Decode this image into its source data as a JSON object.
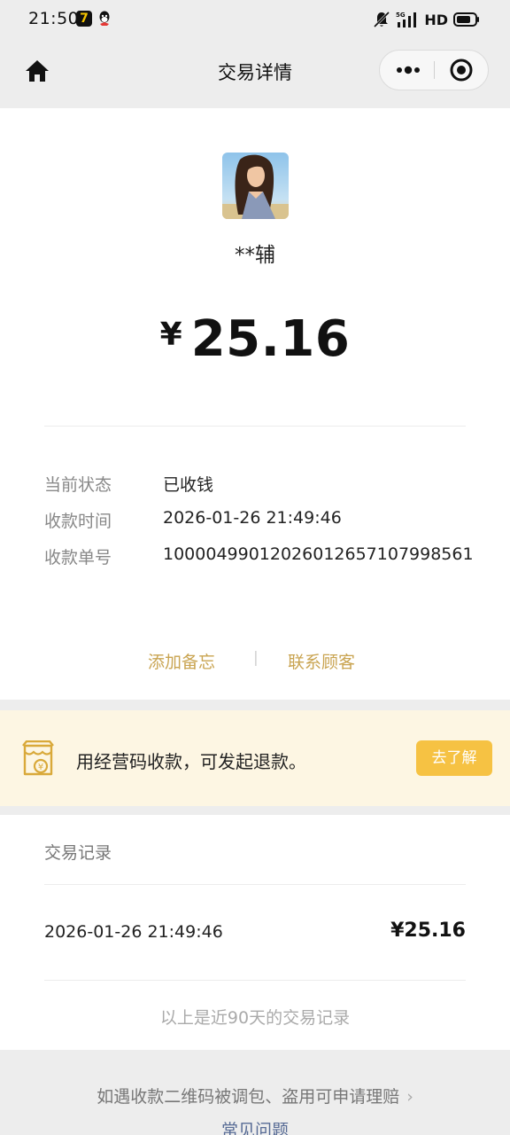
{
  "status_bar": {
    "time": "21:50",
    "network": "5G",
    "hd": "HD"
  },
  "nav": {
    "title": "交易详情"
  },
  "merchant": {
    "name": "**辅"
  },
  "amount": {
    "currency": "¥",
    "value": "25.16"
  },
  "details": [
    {
      "label": "当前状态",
      "value": "已收钱"
    },
    {
      "label": "收款时间",
      "value": "2026-01-26 21:49:46"
    },
    {
      "label": "收款单号",
      "value": "1000049901202601265710799856​1"
    }
  ],
  "actions": {
    "remark": "添加备忘",
    "separator": "|",
    "contact": "联系顾客"
  },
  "banner": {
    "text": "用经营码收款，可发起退款。",
    "button": "去了解"
  },
  "records": {
    "title": "交易记录",
    "items": [
      {
        "time": "2026-01-26 21:49:46",
        "amount": "¥25.16"
      }
    ],
    "footer": "以上是近90天的交易记录"
  },
  "bottom": {
    "claim": "如遇收款二维码被调包、盗用可申请理赔",
    "faq": "常见问题"
  },
  "colors": {
    "accent_gold": "#c9a451",
    "button_yellow": "#f6c243",
    "banner_bg": "#fdf6e3",
    "link_blue": "#576b95"
  }
}
